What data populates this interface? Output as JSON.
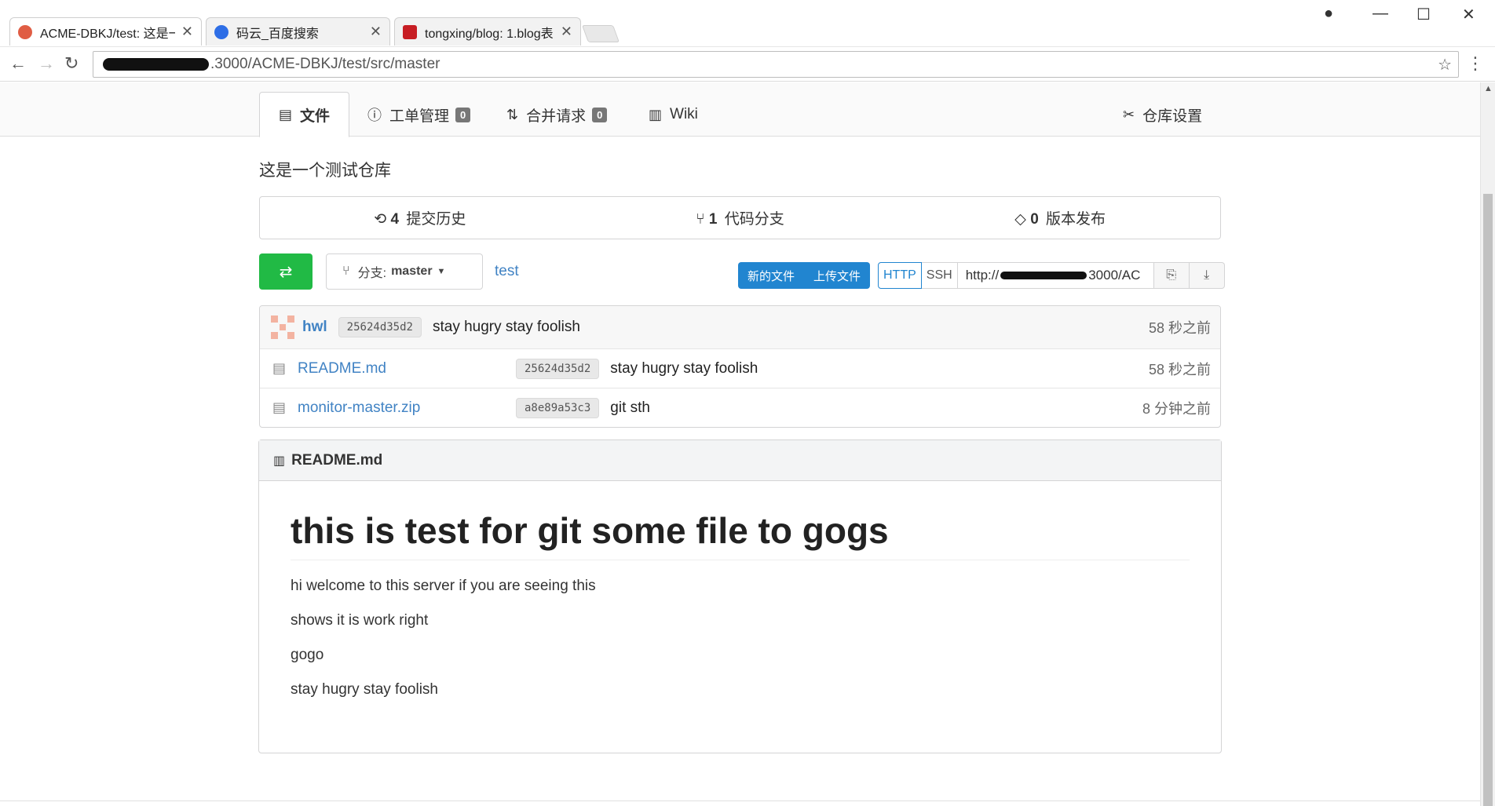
{
  "browser": {
    "tabs": [
      {
        "title": "ACME-DBKJ/test: 这是一",
        "favicon_color": "#e05d44",
        "active": true
      },
      {
        "title": "码云_百度搜索",
        "favicon_color": "#2e6ee6",
        "active": false
      },
      {
        "title": "tongxing/blog: 1.blog表",
        "favicon_color": "#c71d23",
        "active": false
      }
    ],
    "tab_close": "✕",
    "address": ".3000/ACME-DBKJ/test/src/master"
  },
  "repo_nav": {
    "files": "文件",
    "issues": "工单管理",
    "issues_count": "0",
    "pulls": "合并请求",
    "pulls_count": "0",
    "wiki": "Wiki",
    "settings": "仓库设置"
  },
  "description": "这是一个测试仓库",
  "stats": {
    "commits_count": "4",
    "commits_label": "提交历史",
    "branches_count": "1",
    "branches_label": "代码分支",
    "releases_count": "0",
    "releases_label": "版本发布"
  },
  "actions": {
    "branch_prefix": "分支:",
    "branch_name": "master",
    "repo_link": "test",
    "new_file": "新的文件",
    "upload_file": "上传文件",
    "http": "HTTP",
    "ssh": "SSH",
    "clone_url_start": "http://",
    "clone_url_end": "3000/AC"
  },
  "latest_commit": {
    "author": "hwl",
    "sha": "25624d35d2",
    "message": "stay hugry stay foolish",
    "age": "58 秒之前"
  },
  "files": [
    {
      "name": "README.md",
      "sha": "25624d35d2",
      "message": "stay hugry stay foolish",
      "age": "58 秒之前"
    },
    {
      "name": "monitor-master.zip",
      "sha": "a8e89a53c3",
      "message": "git sth",
      "age": "8 分钟之前"
    }
  ],
  "readme": {
    "title": "README.md",
    "heading": "this is test for git some file to gogs",
    "paragraphs": [
      "hi welcome to this server if you are seeing this",
      "shows it is work right",
      "gogo",
      "stay hugry stay foolish"
    ]
  },
  "colors": {
    "accent_blue": "#2185d0",
    "link_blue": "#4183c4",
    "green": "#21ba45"
  }
}
